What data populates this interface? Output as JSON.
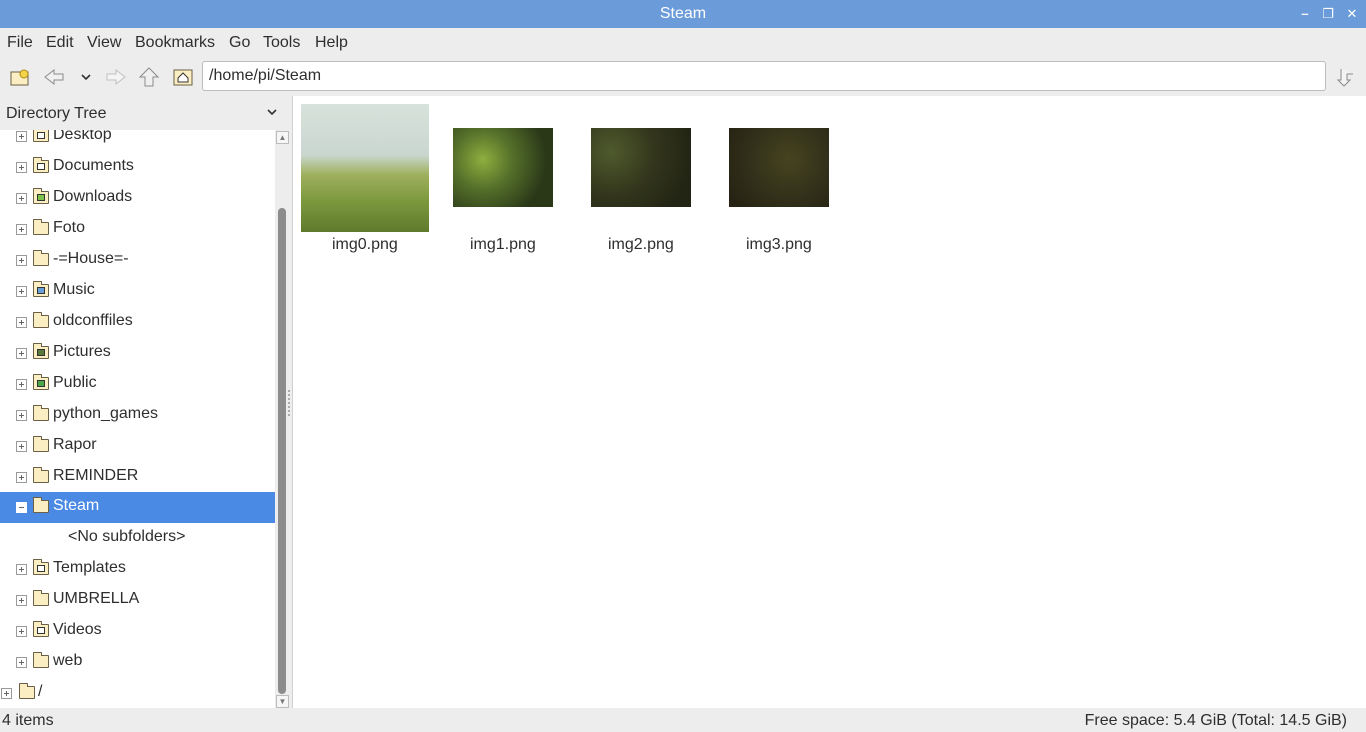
{
  "window": {
    "title": "Steam"
  },
  "menu": [
    "File",
    "Edit",
    "View",
    "Bookmarks",
    "Go",
    "Tools",
    "Help"
  ],
  "toolbar": {
    "path": "/home/pi/Steam"
  },
  "sidebar": {
    "header": "Directory Tree",
    "items": [
      {
        "label": "Desktop",
        "icon": "desktop-folder-icon",
        "expand": "plus"
      },
      {
        "label": "Documents",
        "icon": "documents-folder-icon",
        "expand": "plus"
      },
      {
        "label": "Downloads",
        "icon": "downloads-folder-icon",
        "expand": "plus"
      },
      {
        "label": "Foto",
        "icon": "folder-icon",
        "expand": "plus"
      },
      {
        "label": "-=House=-",
        "icon": "folder-icon",
        "expand": "plus"
      },
      {
        "label": "Music",
        "icon": "music-folder-icon",
        "expand": "plus"
      },
      {
        "label": "oldconffiles",
        "icon": "folder-icon",
        "expand": "plus"
      },
      {
        "label": "Pictures",
        "icon": "pictures-folder-icon",
        "expand": "plus"
      },
      {
        "label": "Public",
        "icon": "public-folder-icon",
        "expand": "plus"
      },
      {
        "label": "python_games",
        "icon": "folder-icon",
        "expand": "plus"
      },
      {
        "label": "Rapor",
        "icon": "folder-icon",
        "expand": "plus"
      },
      {
        "label": "REMINDER",
        "icon": "folder-icon",
        "expand": "plus"
      },
      {
        "label": "Steam",
        "icon": "folder-icon",
        "expand": "minus",
        "selected": true
      },
      {
        "label": "<No subfolders>",
        "icon": "",
        "expand": "none"
      },
      {
        "label": "Templates",
        "icon": "templates-folder-icon",
        "expand": "plus"
      },
      {
        "label": "UMBRELLA",
        "icon": "folder-icon",
        "expand": "plus"
      },
      {
        "label": "Videos",
        "icon": "videos-folder-icon",
        "expand": "plus"
      },
      {
        "label": "web",
        "icon": "folder-icon",
        "expand": "plus"
      },
      {
        "label": "/",
        "icon": "folder-icon",
        "expand": "plus"
      }
    ]
  },
  "files": [
    {
      "name": "img0.png",
      "colors": [
        "#cfd9d3",
        "#8fa05a",
        "#6f8a35"
      ]
    },
    {
      "name": "img1.png",
      "colors": [
        "#2b3a18",
        "#7e9a34",
        "#4d6621"
      ]
    },
    {
      "name": "img2.png",
      "colors": [
        "#2c2d19",
        "#3f4422",
        "#1e2012"
      ]
    },
    {
      "name": "img3.png",
      "colors": [
        "#2f2c18",
        "#3b3a1f",
        "#242214"
      ]
    }
  ],
  "status": {
    "items": "4 items",
    "free_space": "Free space: 5.4 GiB (Total: 14.5 GiB)"
  },
  "colors": {
    "titlebar": "#6b9bd9",
    "selection": "#4a8ae4",
    "folder": "#fbeec2"
  }
}
